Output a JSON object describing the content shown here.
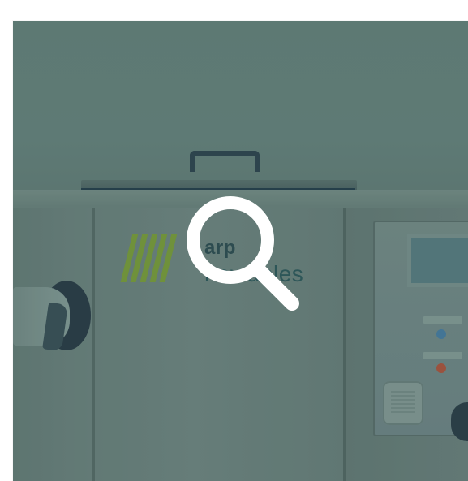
{
  "thumbnail": {
    "logo_line1": "arp",
    "logo_line2": "newables",
    "colors": {
      "overlay": "#28463f",
      "logo_green": "#7fa13a",
      "machine_steel": "#6f8480",
      "wall": "#6b8580"
    }
  },
  "zoom": {
    "icon": "magnifier-icon",
    "color": "#ffffff"
  }
}
